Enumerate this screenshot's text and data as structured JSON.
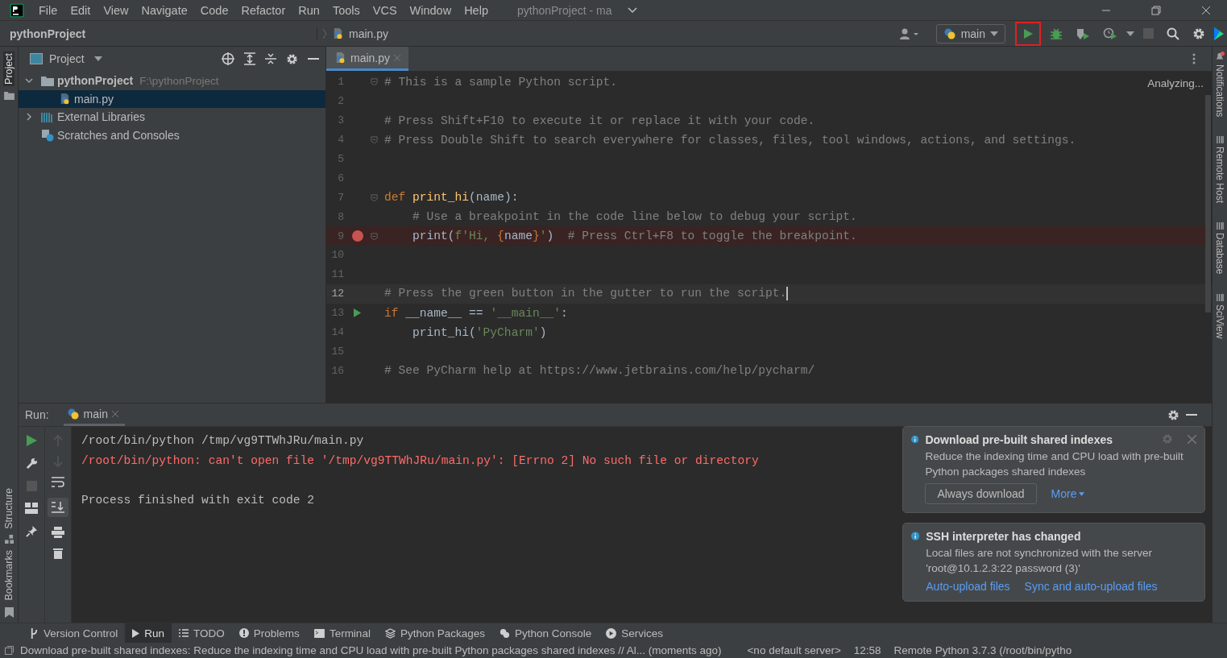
{
  "title_bar": {
    "menu": [
      "File",
      "Edit",
      "View",
      "Navigate",
      "Code",
      "Refactor",
      "Run",
      "Tools",
      "VCS",
      "Window",
      "Help"
    ],
    "project_title": "pythonProject - ma"
  },
  "breadcrumb": [
    {
      "label": "pythonProject",
      "kind": "project"
    },
    {
      "label": "main.py",
      "kind": "file"
    }
  ],
  "toolbar": {
    "run_config": "main",
    "run_highlighted": true
  },
  "left_stripe": {
    "top": [
      {
        "label": "Project",
        "selected": true
      }
    ],
    "bottom": [
      {
        "label": "Structure",
        "selected": false
      },
      {
        "label": "Bookmarks",
        "selected": false
      }
    ]
  },
  "project_panel": {
    "title": "Project",
    "tree": [
      {
        "label": "pythonProject",
        "kind": "folder",
        "path": "F:\\pythonProject",
        "expanded": true,
        "selected": false,
        "children": [
          {
            "label": "main.py",
            "kind": "python",
            "selected": true
          }
        ]
      },
      {
        "label": "External Libraries",
        "kind": "libraries",
        "expanded": false,
        "selected": false
      },
      {
        "label": "Scratches and Consoles",
        "kind": "scratches",
        "selected": false
      }
    ]
  },
  "editor": {
    "tabs": [
      {
        "label": "main.py",
        "selected": true
      }
    ],
    "status": "Analyzing...",
    "lines": [
      {
        "number": "1",
        "fold": true,
        "current": false,
        "breakpoint": false,
        "runnable": false,
        "indented": false,
        "tokens": [
          {
            "kind": "comment",
            "text": "# This is a sample Python script."
          }
        ]
      },
      {
        "number": "2",
        "fold": false,
        "current": false,
        "breakpoint": false,
        "runnable": false
      },
      {
        "number": "3",
        "fold": false,
        "current": false,
        "breakpoint": false,
        "runnable": false,
        "indented": false,
        "tokens": [
          {
            "kind": "comment",
            "text": "# Press Shift+F10 to execute it or replace it with your code."
          }
        ]
      },
      {
        "number": "4",
        "fold": true,
        "current": false,
        "breakpoint": false,
        "runnable": false,
        "indented": false,
        "tokens": [
          {
            "kind": "comment",
            "text": "# Press Double Shift to search everywhere for classes, files, tool windows, actions, and settings."
          }
        ]
      },
      {
        "number": "5",
        "fold": false,
        "current": false,
        "breakpoint": false,
        "runnable": false
      },
      {
        "number": "6",
        "fold": false,
        "current": false,
        "breakpoint": false,
        "runnable": false
      },
      {
        "number": "7",
        "fold": true,
        "current": false,
        "breakpoint": false,
        "runnable": false,
        "indented": false,
        "tokens": [
          {
            "kind": "keyword",
            "text": "def"
          },
          {
            "kind": "function",
            "text": " print_hi"
          },
          {
            "kind": "plain",
            "text": "(name):"
          }
        ]
      },
      {
        "number": "8",
        "fold": false,
        "current": false,
        "breakpoint": false,
        "runnable": false,
        "indented": true,
        "tokens": [
          {
            "kind": "comment",
            "text": "# Use a breakpoint in the code line below to debug your script."
          }
        ]
      },
      {
        "number": "9",
        "fold": true,
        "current": false,
        "breakpoint": true,
        "runnable": false,
        "indented": true,
        "tokens": [
          {
            "kind": "plain",
            "text": "print("
          },
          {
            "kind": "string",
            "text": "f'Hi, "
          },
          {
            "kind": "keyword",
            "text": "{"
          },
          {
            "kind": "plain",
            "text": "name"
          },
          {
            "kind": "keyword",
            "text": "}"
          },
          {
            "kind": "string",
            "text": "'"
          },
          {
            "kind": "plain",
            "text": ")"
          },
          {
            "kind": "comment",
            "text": "  # Press Ctrl+F8 to toggle the breakpoint."
          }
        ]
      },
      {
        "number": "10",
        "fold": false,
        "current": false,
        "breakpoint": false,
        "runnable": false
      },
      {
        "number": "11",
        "fold": false,
        "current": false,
        "breakpoint": false,
        "runnable": false
      },
      {
        "number": "12",
        "fold": false,
        "current": true,
        "breakpoint": false,
        "runnable": false,
        "indented": false,
        "tokens": [
          {
            "kind": "comment",
            "text": "# Press the green button in the gutter to run the script."
          }
        ]
      },
      {
        "number": "13",
        "fold": false,
        "current": false,
        "breakpoint": false,
        "runnable": true,
        "indented": false,
        "tokens": [
          {
            "kind": "keyword",
            "text": "if"
          },
          {
            "kind": "plain",
            "text": " __name__ == "
          },
          {
            "kind": "string",
            "text": "'__main__'"
          },
          {
            "kind": "plain",
            "text": ":"
          }
        ]
      },
      {
        "number": "14",
        "fold": false,
        "current": false,
        "breakpoint": false,
        "runnable": false,
        "indented": true,
        "tokens": [
          {
            "kind": "plain",
            "text": "print_hi("
          },
          {
            "kind": "string",
            "text": "'PyCharm'"
          },
          {
            "kind": "plain",
            "text": ")"
          }
        ]
      },
      {
        "number": "15",
        "fold": false,
        "current": false,
        "breakpoint": false,
        "runnable": false
      },
      {
        "number": "16",
        "fold": false,
        "current": false,
        "breakpoint": false,
        "runnable": false,
        "indented": false,
        "tokens": [
          {
            "kind": "comment",
            "text": "# See PyCharm help at https://www.jetbrains.com/help/pycharm/"
          }
        ]
      }
    ]
  },
  "right_stripe": [
    {
      "label": "Notifications",
      "kind": "notifications"
    },
    {
      "label": "Remote Host",
      "kind": "remote"
    },
    {
      "label": "Database",
      "kind": "database"
    },
    {
      "label": "SciView",
      "kind": "sciview"
    }
  ],
  "run_panel": {
    "label": "Run:",
    "tabs": [
      {
        "label": "main",
        "selected": true
      }
    ],
    "console": [
      {
        "kind": "command",
        "text": "/root/bin/python /tmp/vg9TTWhJRu/main.py"
      },
      {
        "kind": "error",
        "text": "/root/bin/python: can't open file '/tmp/vg9TTWhJRu/main.py': [Errno 2] No such file or directory"
      },
      {
        "kind": "exit",
        "text": "Process finished with exit code 2"
      }
    ]
  },
  "notifications": [
    {
      "title": "Download pre-built shared indexes",
      "body": "Reduce the indexing time and CPU load with pre-built Python packages shared indexes",
      "show_controls": true,
      "actions": [
        {
          "label": "Always download",
          "kind": "button"
        },
        {
          "label": "More",
          "kind": "dropdown"
        }
      ]
    },
    {
      "title": "SSH interpreter has changed",
      "body": "Local files are not synchronized with the server 'root@10.1.2.3:22 password (3)'",
      "show_controls": false,
      "actions": [
        {
          "label": "Auto-upload files",
          "kind": "link"
        },
        {
          "label": "Sync and auto-upload files",
          "kind": "link"
        }
      ]
    }
  ],
  "tool_bar": [
    {
      "label": "Version Control",
      "selected": false
    },
    {
      "label": "Run",
      "selected": true
    },
    {
      "label": "TODO",
      "selected": false
    },
    {
      "label": "Problems",
      "selected": false
    },
    {
      "label": "Terminal",
      "selected": false
    },
    {
      "label": "Python Packages",
      "selected": false
    },
    {
      "label": "Python Console",
      "selected": false
    },
    {
      "label": "Services",
      "selected": false
    }
  ],
  "status_bar": {
    "message": "Download pre-built shared indexes: Reduce the indexing time and CPU load with pre-built Python packages shared indexes // Al... (moments ago)",
    "server": "<no default server>",
    "position": "12:58",
    "interpreter": "Remote Python 3.7.3 (/root/bin/pytho"
  }
}
